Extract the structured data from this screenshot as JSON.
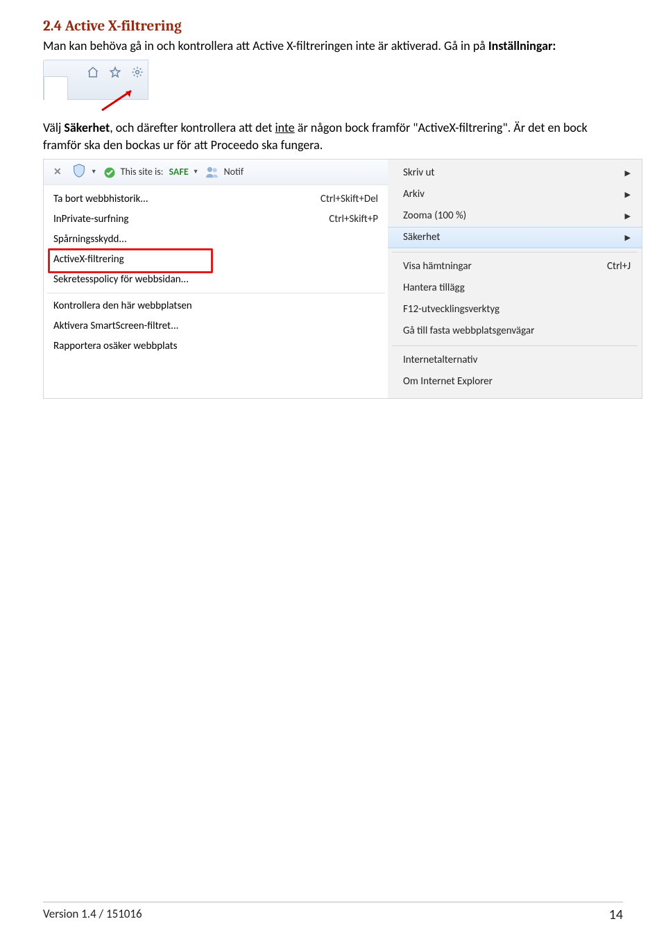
{
  "heading": "2.4 Active X-filtrering",
  "para1_a": "Man kan behöva gå in och kontrollera att Active X-filtreringen inte är aktiverad. Gå in på ",
  "para1_b": "Inställningar:",
  "para2_a": "Välj ",
  "para2_b": "Säkerhet",
  "para2_c": ", och därefter kontrollera att det ",
  "para2_d": "inte",
  "para2_e": " är någon bock framför \"ActiveX-filtrering\". Är det en bock framför ska den bockas ur för att Proceedo ska fungera.",
  "iebar": {
    "site_label": "This site is:",
    "site_status": "SAFE",
    "notif": "Notif"
  },
  "submenu": [
    {
      "label": "Ta bort webbhistorik...",
      "shortcut": "Ctrl+Skift+Del"
    },
    {
      "label": "InPrivate-surfning",
      "shortcut": "Ctrl+Skift+P"
    },
    {
      "label": "Spårningsskydd...",
      "shortcut": ""
    },
    {
      "label": "ActiveX-filtrering",
      "shortcut": ""
    },
    {
      "label": "Sekretesspolicy för webbsidan...",
      "shortcut": ""
    }
  ],
  "submenu2": [
    {
      "label": "Kontrollera den här webbplatsen",
      "shortcut": ""
    },
    {
      "label": "Aktivera SmartScreen-filtret...",
      "shortcut": ""
    },
    {
      "label": "Rapportera osäker webbplats",
      "shortcut": ""
    }
  ],
  "mainmenu_top": [
    {
      "label": "Skriv ut",
      "arrow": true
    },
    {
      "label": "Arkiv",
      "arrow": true
    },
    {
      "label": "Zooma (100 %)",
      "arrow": true
    },
    {
      "label": "Säkerhet",
      "arrow": true,
      "hover": true
    }
  ],
  "mainmenu_mid": [
    {
      "label": "Visa hämtningar",
      "shortcut": "Ctrl+J"
    },
    {
      "label": "Hantera tillägg"
    },
    {
      "label": "F12-utvecklingsverktyg"
    },
    {
      "label": "Gå till fasta webbplatsgenvägar"
    }
  ],
  "mainmenu_bot": [
    {
      "label": "Internetalternativ"
    },
    {
      "label": "Om Internet Explorer"
    }
  ],
  "footer_version": "Version 1.4 / 151016",
  "footer_page": "14"
}
